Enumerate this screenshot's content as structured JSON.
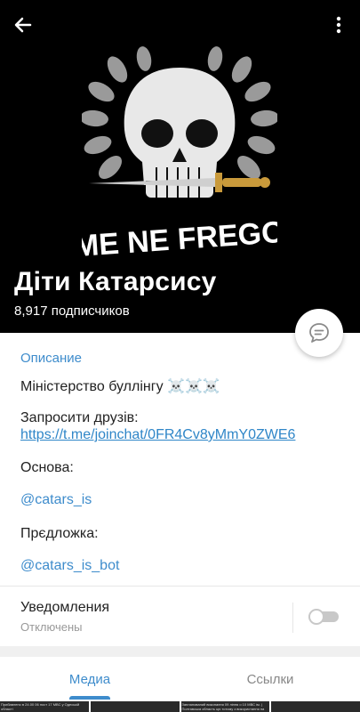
{
  "channel": {
    "title": "Діти Катарсису",
    "subscribers": "8,917 подписчиков",
    "banner_text": "ME NE FREGO"
  },
  "description": {
    "section_title": "Описание",
    "line1": "Міністерство буллінгу ☠️☠️☠️",
    "invite_label": "Запросити друзів:",
    "invite_link": "https://t.me/joinchat/0FR4Cv8yMmY0ZWE6",
    "main_label": "Основа:",
    "main_handle": "@catars_is",
    "suggest_label": "Прєдложка:",
    "suggest_handle": "@catars_is_bot"
  },
  "notifications": {
    "label": "Уведомления",
    "state": "Отключены",
    "enabled": false
  },
  "tabs": [
    {
      "label": "Медиа",
      "active": true
    },
    {
      "label": "Ссылки",
      "active": false
    }
  ],
  "media_previews": [
    "Прибавлено в 24.00 06 пост 17 МВС у Одеській області",
    "",
    "Запланований виконання 09 ліпня о 10 МВС ім. | Полтавська область цю тотому з використання на постійному законодавстві",
    ""
  ],
  "colors": {
    "accent": "#3e8ccc",
    "header_bg": "#000000"
  },
  "icons": {
    "back": "arrow-left-icon",
    "more": "more-vertical-icon",
    "chat": "chat-bubble-icon"
  }
}
